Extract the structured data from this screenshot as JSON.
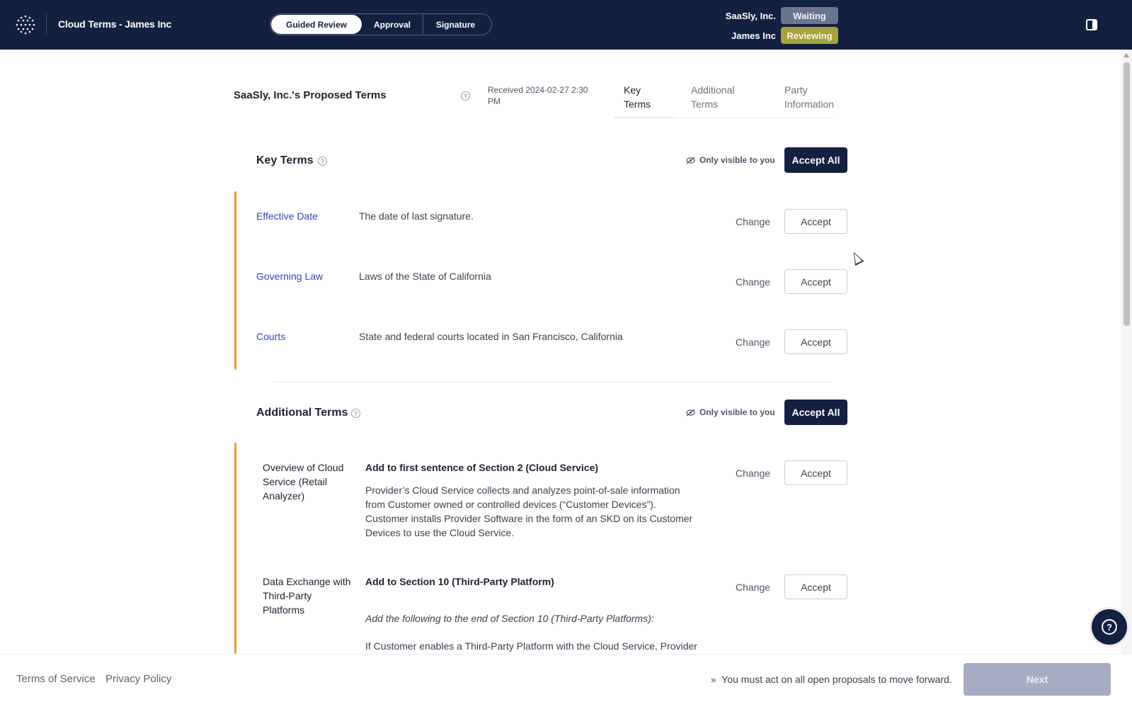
{
  "header": {
    "app_title": "Cloud Terms  - James Inc",
    "steps": [
      "Guided Review",
      "Approval",
      "Signature"
    ],
    "parties": [
      {
        "name": "SaaSly, Inc.",
        "status": "Waiting"
      },
      {
        "name": "James Inc",
        "status": "Reviewing"
      }
    ]
  },
  "document": {
    "title": "SaaSly, Inc.'s Proposed Terms",
    "received": "Received 2024-02-27 2:30 PM",
    "tabs": [
      "Key Terms",
      "Additional Terms",
      "Party Information"
    ]
  },
  "key_terms": {
    "title": "Key Terms",
    "only_visible": "Only visible to you",
    "accept_all": "Accept All",
    "change_label": "Change",
    "accept_label": "Accept",
    "items": [
      {
        "label": "Effective Date",
        "value": "The date of last signature."
      },
      {
        "label": "Governing Law",
        "value": "Laws of the State of California"
      },
      {
        "label": "Courts",
        "value": "State and federal courts located in San Francisco, California"
      }
    ]
  },
  "additional_terms": {
    "title": "Additional Terms",
    "only_visible": "Only visible to you",
    "accept_all": "Accept All",
    "items": [
      {
        "label": "Overview of Cloud Service (Retail Analyzer)",
        "heading": "Add to first sentence of Section 2 (Cloud Service)",
        "body": "Provider’s Cloud Service collects and analyzes point-of-sale information from Customer owned or controlled devices (“Customer Devices”). Customer installs Provider Software in the form of an SKD on its Customer Devices to use the Cloud Service."
      },
      {
        "label": "Data Exchange with Third-Party Platforms",
        "heading": "Add to Section 10 (Third-Party Platform)",
        "italic": "Add the following to the end of Section 10 (Third-Party Platforms):",
        "body": "If Customer enables a Third-Party Platform with the Cloud Service, Provider"
      }
    ]
  },
  "footer": {
    "terms": "Terms of Service",
    "privacy": "Privacy Policy",
    "message": "You must act on all open proposals to move forward.",
    "next": "Next"
  },
  "colors": {
    "header_bg": "#13203f",
    "accent_orange": "#f29a2e",
    "link_blue": "#2e47b8",
    "waiting_badge": "#6b7590",
    "reviewing_badge": "#a6a23e"
  }
}
